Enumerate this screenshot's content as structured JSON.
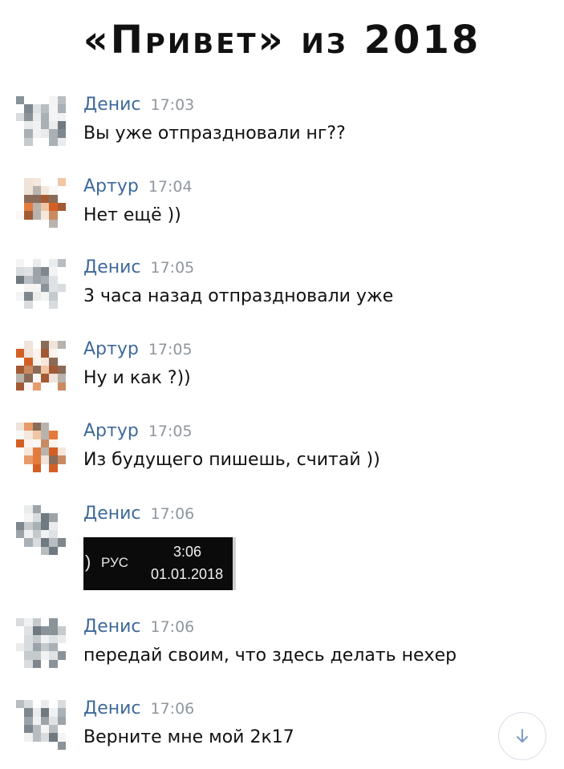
{
  "title": "«Привет» из 2018",
  "colors": {
    "author": "#3f6a9a",
    "time": "#8f969e",
    "text": "#111111",
    "scroll_icon": "#7b9cc4"
  },
  "messages": [
    {
      "author": "Денис",
      "time": "17:03",
      "text": "Вы уже отпраздновали нг??",
      "avatar": "denis"
    },
    {
      "author": "Артур",
      "time": "17:04",
      "text": "Нет ещё ))",
      "avatar": "artur"
    },
    {
      "author": "Денис",
      "time": "17:05",
      "text": "3 часа назад отпраздновали уже",
      "avatar": "denis"
    },
    {
      "author": "Артур",
      "time": "17:05",
      "text": "Ну и как ?))",
      "avatar": "artur"
    },
    {
      "author": "Артур",
      "time": "17:05",
      "text": "Из будущего пишешь, считай ))",
      "avatar": "artur"
    },
    {
      "author": "Денис",
      "time": "17:06",
      "avatar": "denis",
      "attachment": {
        "paren": ")",
        "lang": "РУС",
        "clock": "3:06",
        "date": "01.01.2018"
      }
    },
    {
      "author": "Денис",
      "time": "17:06",
      "text": "передай своим, что здесь делать нехер",
      "avatar": "denis"
    },
    {
      "author": "Денис",
      "time": "17:06",
      "text": "Верните мне мой 2к17",
      "avatar": "denis"
    }
  ],
  "scroll_down_icon": "arrow-down-icon"
}
